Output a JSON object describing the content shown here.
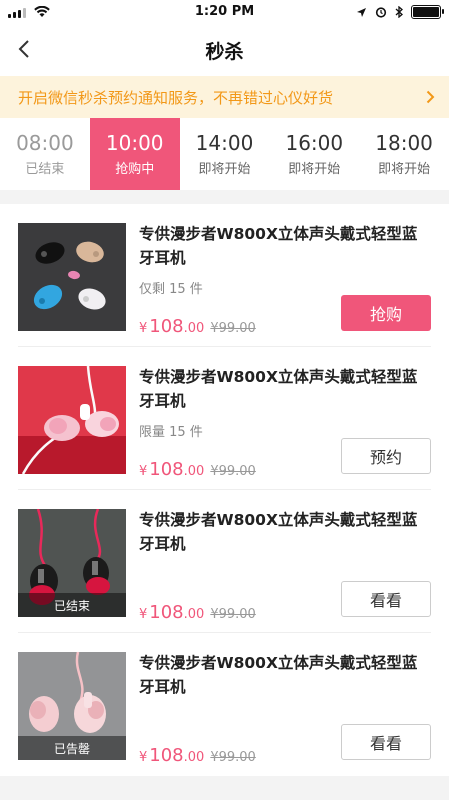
{
  "status_bar": {
    "time": "1:20 PM"
  },
  "nav": {
    "title": "秒杀"
  },
  "notice": {
    "text": "开启微信秒杀预约通知服务，不再错过心仪好货"
  },
  "time_tabs": [
    {
      "time": "08:00",
      "status": "已结束"
    },
    {
      "time": "10:00",
      "status": "抢购中"
    },
    {
      "time": "14:00",
      "status": "即将开始"
    },
    {
      "time": "16:00",
      "status": "即将开始"
    },
    {
      "time": "18:00",
      "status": "即将开始"
    }
  ],
  "products": [
    {
      "name": "专供漫步者W800X立体声头戴式轻型蓝牙耳机",
      "stock": "仅剩 15 件",
      "price_symbol": "¥",
      "price_int": "108",
      "price_dec": ".00",
      "original_price": "¥99.00",
      "button": "抢购",
      "overlay": ""
    },
    {
      "name": "专供漫步者W800X立体声头戴式轻型蓝牙耳机",
      "stock": "限量 15 件",
      "price_symbol": "¥",
      "price_int": "108",
      "price_dec": ".00",
      "original_price": "¥99.00",
      "button": "预约",
      "overlay": ""
    },
    {
      "name": "专供漫步者W800X立体声头戴式轻型蓝牙耳机",
      "stock": "",
      "price_symbol": "¥",
      "price_int": "108",
      "price_dec": ".00",
      "original_price": "¥99.00",
      "button": "看看",
      "overlay": "已结束"
    },
    {
      "name": "专供漫步者W800X立体声头戴式轻型蓝牙耳机",
      "stock": "",
      "price_symbol": "¥",
      "price_int": "108",
      "price_dec": ".00",
      "original_price": "¥99.00",
      "button": "看看",
      "overlay": "已告罄"
    }
  ],
  "colors": {
    "accent": "#f0567a",
    "notice_text": "#f29818",
    "notice_bg": "#fdf3dc"
  }
}
